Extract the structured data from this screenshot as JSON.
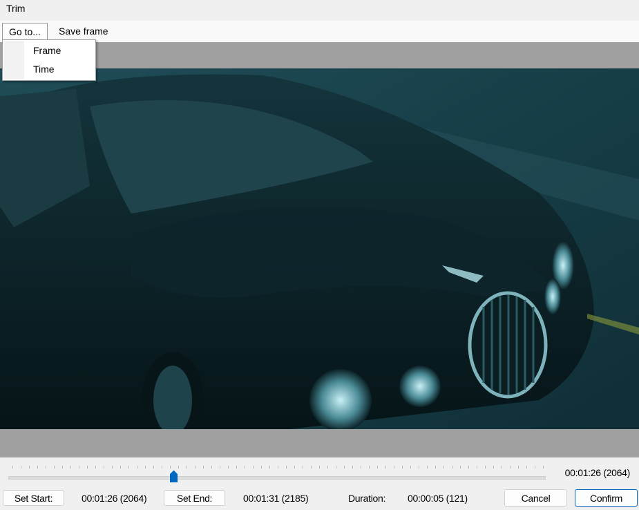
{
  "window": {
    "title": "Trim"
  },
  "menu": {
    "goto_label": "Go to...",
    "save_frame_label": "Save frame",
    "goto_items": [
      {
        "label": "Frame"
      },
      {
        "label": "Time"
      }
    ]
  },
  "slider": {
    "position_fraction": 0.308,
    "current_time": "00:01:26 (2064)"
  },
  "controls": {
    "set_start_label": "Set Start:",
    "start_value": "00:01:26 (2064)",
    "set_end_label": "Set End:",
    "end_value": "00:01:31 (2185)",
    "duration_label": "Duration:",
    "duration_value": "00:00:05 (121)",
    "cancel_label": "Cancel",
    "confirm_label": "Confirm"
  },
  "colors": {
    "accent": "#0067c0",
    "video_bg": "#163b44",
    "letterbox": "#a0a0a0"
  }
}
